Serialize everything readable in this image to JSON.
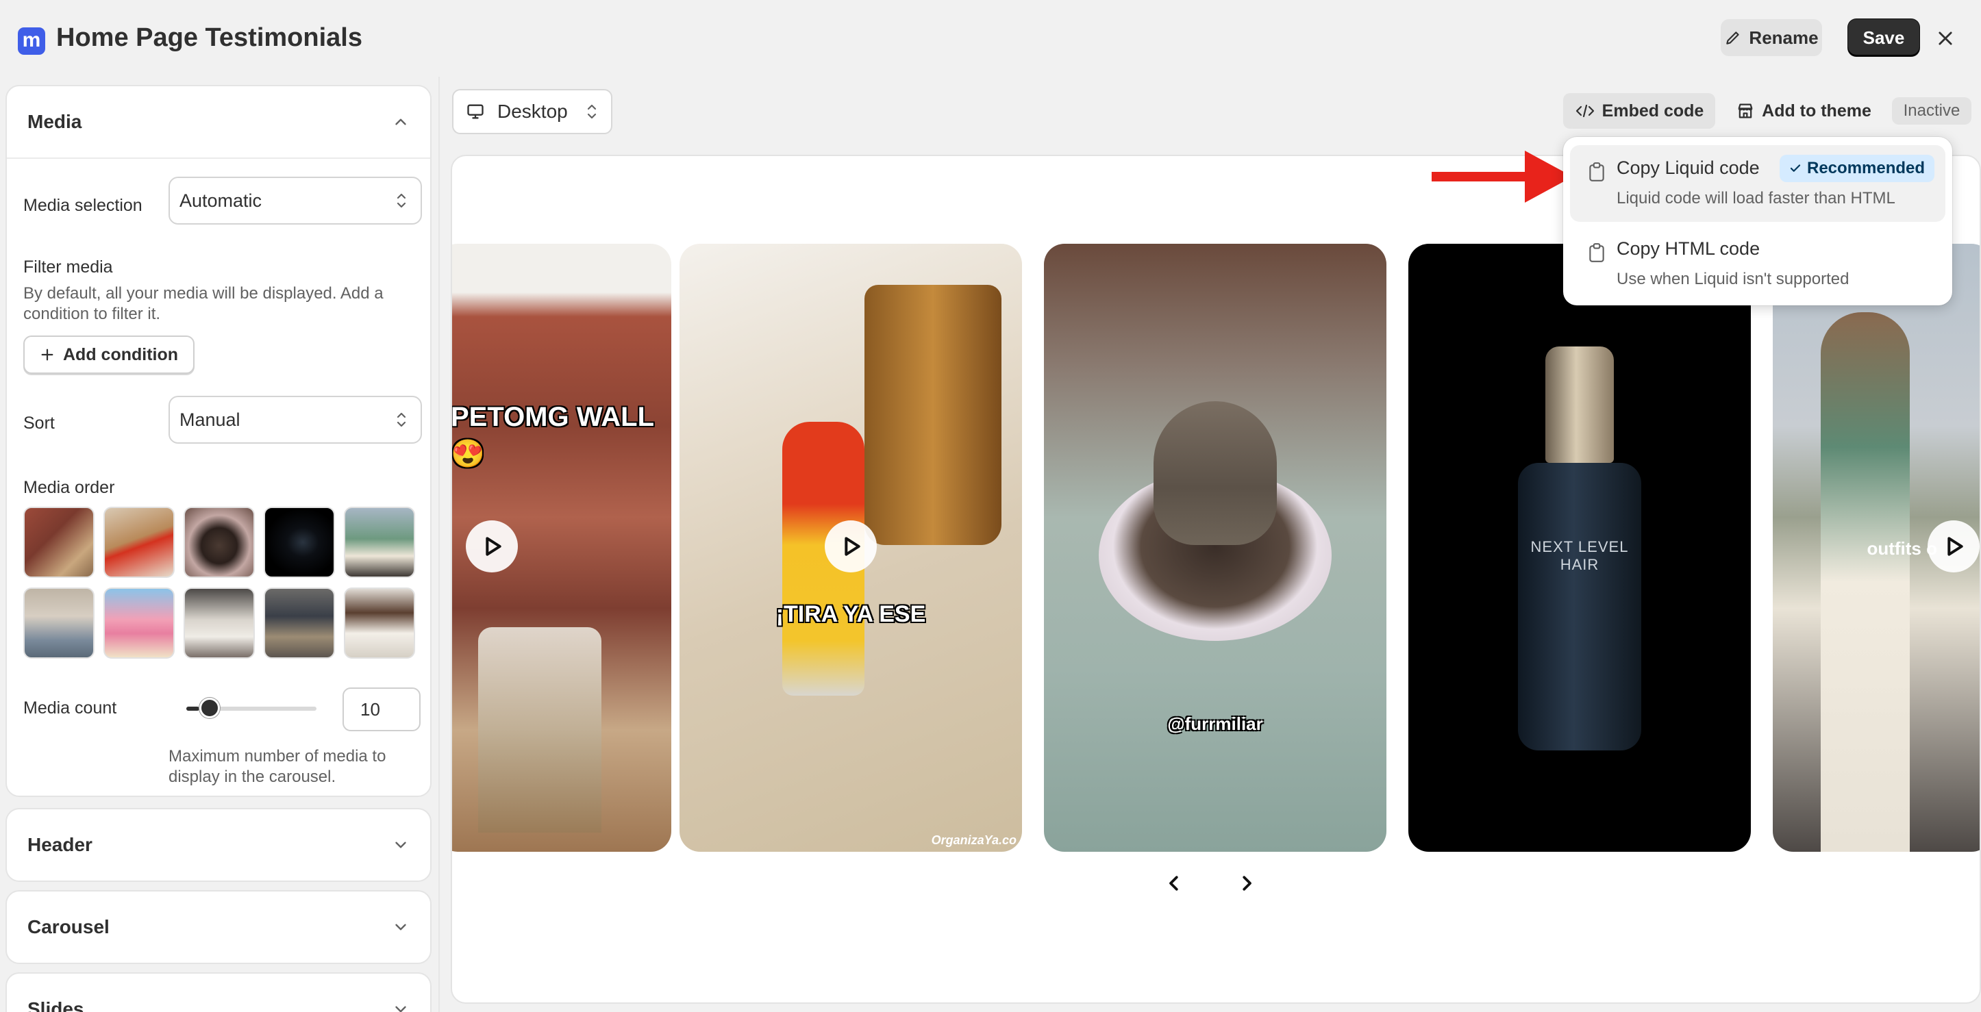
{
  "app": {
    "logo_letter": "m",
    "title": "Home Page Testimonials",
    "rename_label": "Rename",
    "save_label": "Save"
  },
  "sidebar": {
    "media": {
      "title": "Media",
      "media_selection_label": "Media selection",
      "media_selection_value": "Automatic",
      "filter_media_label": "Filter media",
      "filter_help": "By default, all your media will be displayed. Add a condition to filter it.",
      "add_condition_label": "Add condition",
      "sort_label": "Sort",
      "sort_value": "Manual",
      "media_order_label": "Media order",
      "media_count_label": "Media count",
      "media_count_value": "10",
      "media_count_fraction": 0.1,
      "media_count_help": "Maximum number of media to display in the carousel."
    },
    "sections": [
      "Header",
      "Carousel",
      "Slides"
    ]
  },
  "toolbar": {
    "device_label": "Desktop",
    "embed_label": "Embed code",
    "add_theme_label": "Add to theme",
    "status_label": "Inactive"
  },
  "embed_menu": {
    "items": [
      {
        "title": "Copy Liquid code",
        "badge": "Recommended",
        "subtitle": "Liquid code will load faster than HTML"
      },
      {
        "title": "Copy HTML code",
        "subtitle": "Use when Liquid isn't supported"
      }
    ]
  },
  "slides": [
    {
      "overlay": "PETOMG WALL 😍"
    },
    {
      "overlay": "¡TIRA YA ESE",
      "watermark": "OrganizaYa.co"
    },
    {
      "overlay": "@furrmiliar"
    },
    {
      "overlay": "NEXT LEVEL HAIR"
    },
    {
      "overlay": "outfits o"
    }
  ],
  "colors": {
    "accent": "#3f5ee8",
    "save_bg": "#303030",
    "badge_bg": "#d5ebff",
    "arrow": "#e8231b"
  }
}
